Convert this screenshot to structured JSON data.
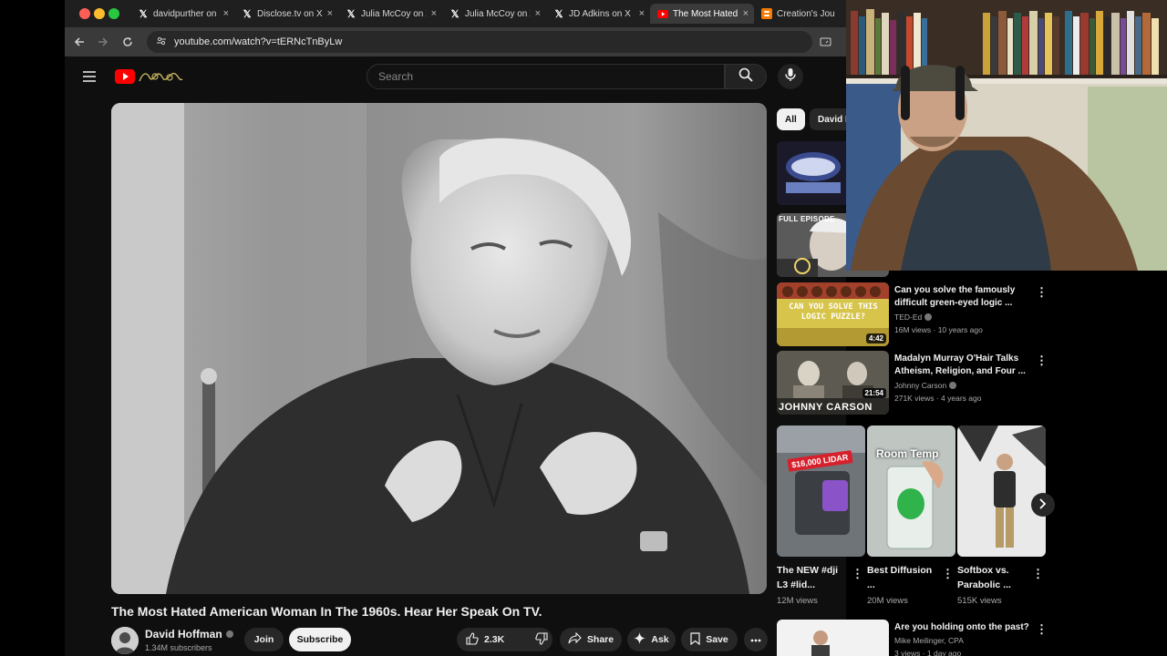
{
  "browser": {
    "tabs": [
      {
        "icon": "x-logo-icon",
        "title": "davidpurther on X"
      },
      {
        "icon": "x-logo-icon",
        "title": "Disclose.tv on X"
      },
      {
        "icon": "x-logo-icon",
        "title": "Julia McCoy on X"
      },
      {
        "icon": "x-logo-icon",
        "title": "Julia McCoy on X"
      },
      {
        "icon": "x-logo-icon",
        "title": "JD Adkins on X"
      },
      {
        "icon": "youtube-logo-icon",
        "title": "The Most Hated"
      },
      {
        "icon": "blogger-logo-icon",
        "title": "Creation's Jou"
      }
    ],
    "close_glyph": "×",
    "url": "youtube.com/watch?v=tERNcTnByLw"
  },
  "youtube": {
    "search_placeholder": "Search",
    "chips": [
      "All",
      "David I"
    ],
    "video": {
      "title": "The Most Hated American Woman In The 1960s. Hear Her Speak On TV.",
      "channel": "David Hoffman",
      "subscribers": "1.34M subscribers",
      "join_label": "Join",
      "subscribe_label": "Subscribe",
      "likes": "2.3K",
      "share_label": "Share",
      "ask_label": "Ask",
      "save_label": "Save"
    },
    "recommendations": [
      {
        "title": "",
        "channel": "",
        "meta": "",
        "duration": ""
      },
      {
        "title": "",
        "channel": "",
        "meta": "",
        "duration": "",
        "thumb_text": "FULL EPISODE"
      },
      {
        "title": "Can you solve the famously difficult green-eyed logic ...",
        "channel": "TED-Ed",
        "meta": "16M views · 10 years ago",
        "duration": "4:42",
        "thumb_text": "CAN YOU SOLVE THIS LOGIC PUZZLE?"
      },
      {
        "title": "Madalyn Murray O'Hair Talks Atheism, Religion, and Four ...",
        "channel": "Johnny Carson",
        "meta": "271K views · 4 years ago",
        "duration": "21:54",
        "thumb_text": "JOHNNY CARSON"
      },
      {
        "title": "Are you holding onto the past?",
        "channel": "Mike Meilinger, CPA",
        "meta": "3 views · 1 day ago",
        "duration": ""
      }
    ],
    "shorts": [
      {
        "title": "The NEW #dji L3 #lid...",
        "views": "12M views",
        "thumb_text": "$16,000 LIDAR"
      },
      {
        "title": "Best Diffusion ...",
        "views": "20M views",
        "thumb_text": "Room Temp"
      },
      {
        "title": "Softbox vs. Parabolic ...",
        "views": "515K views",
        "thumb_text": ""
      }
    ]
  },
  "colors": {
    "youtube_red": "#ff0000",
    "tab_bar": "#1f1f1f",
    "page_bg": "#0f0f0f",
    "subscribe_bg": "#f1f1f1"
  }
}
